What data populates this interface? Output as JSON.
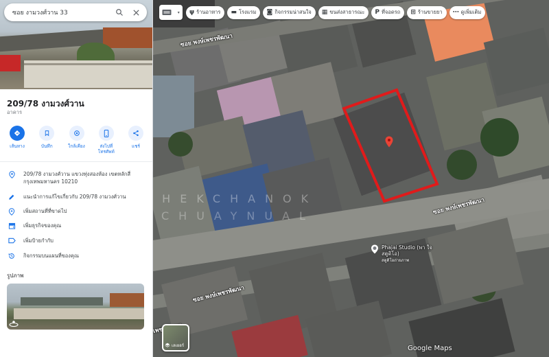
{
  "search": {
    "value": "ซอย งามวงศ์วาน 33"
  },
  "place": {
    "title": "209/78 งามวงศ์วาน",
    "type": "อาคาร"
  },
  "actions": [
    {
      "label": "เส้นทาง",
      "icon": "directions-icon"
    },
    {
      "label": "บันทึก",
      "icon": "bookmark-icon"
    },
    {
      "label": "ใกล้เคียง",
      "icon": "nearby-icon"
    },
    {
      "label": "ส่งไปที่โทรศัพท์",
      "icon": "phone-icon"
    },
    {
      "label": "แชร์",
      "icon": "share-icon"
    }
  ],
  "info": {
    "address": "209/78 งามวงศ์วาน แขวงทุ่งสองห้อง เขตหลักสี่ กรุงเทพมหานคร 10210",
    "suggest_edit": "แนะนำการแก้ไขเกี่ยวกับ 209/78 งามวงศ์วาน",
    "add_missing": "เพิ่มสถานที่ที่ขาดไป",
    "add_business": "เพิ่มธุรกิจของคุณ",
    "add_label": "เพิ่มป้ายกำกับ",
    "activity": "กิจกรรมบนแผนที่ของคุณ"
  },
  "photos": {
    "heading": "รูปภาพ"
  },
  "chips": [
    {
      "label": "ร้านอาหาร",
      "icon": "restaurant-icon"
    },
    {
      "label": "โรงแรม",
      "icon": "hotel-icon"
    },
    {
      "label": "กิจกรรมน่าสนใจ",
      "icon": "camera-icon"
    },
    {
      "label": "ขนส่งสาธารณะ",
      "icon": "transit-icon"
    },
    {
      "label": "ที่จอดรถ",
      "icon": "parking-icon"
    },
    {
      "label": "ร้านขายยา",
      "icon": "pharmacy-icon"
    },
    {
      "label": "ดูเพิ่มเติม",
      "icon": "more-icon"
    }
  ],
  "map": {
    "street_top": "ซอย พงษ์เพชรพัฒนา",
    "street_mid": "ซอย พงษ์เพชรพัฒนา",
    "street_lower": "ซอย พงษ์เพชรพัฒนา",
    "street_bottom_left": "เพชรพัฒนา",
    "poi_name": "Phajai Studio (พา ใจสตูดิโอ)",
    "poi_sub": "สตูดิโอถ่ายภาพ",
    "watermark_line1": "CHEKCHANOK",
    "watermark_line2": "CHUAYNUAL",
    "layers_label": "เลเยอร์",
    "google_logo": "Google Maps"
  },
  "colors": {
    "accent": "#1a73e8",
    "highlight": "#e01b1b",
    "pin": "#ea4335"
  }
}
